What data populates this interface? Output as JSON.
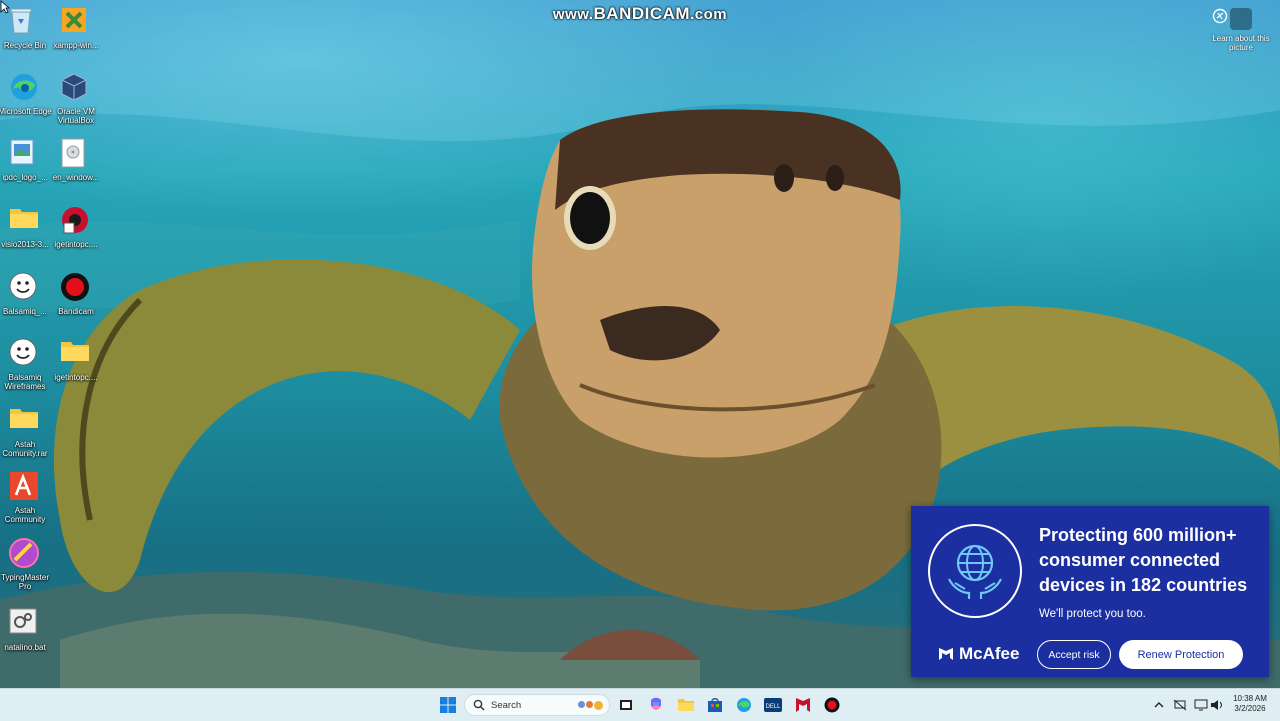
{
  "watermark": {
    "prefix": "www.",
    "brand": "BANDICAM",
    "suffix": ".com"
  },
  "learn_picture": {
    "label": "Learn about this picture",
    "icon": "camera-lens-icon"
  },
  "desktop_icons": [
    {
      "label": "Recycle Bin",
      "icon": "recycle-bin-icon"
    },
    {
      "label": "xampp-win...",
      "icon": "xampp-icon"
    },
    {
      "label": "Microsoft Edge",
      "icon": "edge-icon"
    },
    {
      "label": "Oracle VM VirtualBox",
      "icon": "virtualbox-icon"
    },
    {
      "label": "ipdc_logo_...",
      "icon": "image-file-icon"
    },
    {
      "label": "en_window...",
      "icon": "disc-image-icon"
    },
    {
      "label": "visio2013-3...",
      "icon": "folder-icon"
    },
    {
      "label": "igetintopc....",
      "icon": "installer-icon"
    },
    {
      "label": "Balsamiq_...",
      "icon": "balsamiq-icon"
    },
    {
      "label": "Bandicam",
      "icon": "bandicam-icon"
    },
    {
      "label": "Balsamiq Wireframes",
      "icon": "balsamiq-icon"
    },
    {
      "label": "igetintopc....",
      "icon": "folder-icon"
    },
    {
      "label": "Astah Comunity.rar",
      "icon": "folder-icon"
    },
    {
      "label": "Astah Community",
      "icon": "astah-icon"
    },
    {
      "label": "TypingMaster Pro",
      "icon": "typingmaster-icon"
    },
    {
      "label": "natalino.bat",
      "icon": "batch-file-icon"
    }
  ],
  "mcafee": {
    "headline": "Protecting 600 million+ consumer connected devices in 182 countries",
    "subtext": "We'll protect you too.",
    "brand": "McAfee",
    "accept_label": "Accept risk",
    "renew_label": "Renew Protection",
    "colors": {
      "background": "#1b2fa0",
      "button": "#ffffff"
    }
  },
  "taskbar": {
    "search_placeholder": "Search",
    "pinned": [
      "start-icon",
      "search-icon",
      "task-view-icon",
      "copilot-icon",
      "file-explorer-icon",
      "store-icon",
      "edge-icon",
      "dell-icon",
      "mcafee-icon",
      "bandicam-icon"
    ],
    "tray": [
      "chevron-up-icon",
      "network-off-icon",
      "monitor-icon",
      "speaker-icon"
    ],
    "time": "10:38 AM",
    "date": "3/2/2026"
  }
}
